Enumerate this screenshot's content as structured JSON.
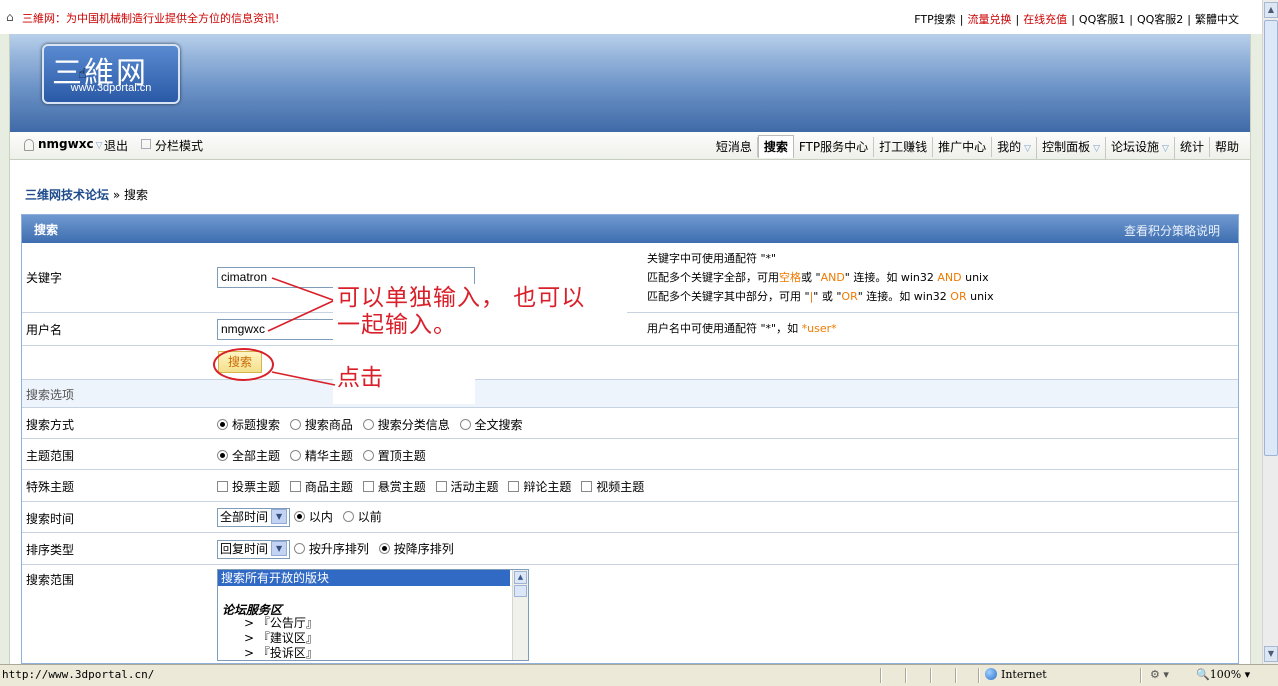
{
  "topbar": {
    "slogan": "三維网：为中国机械制造行业提供全方位的信息资讯!",
    "links": [
      "FTP搜索",
      "流量兑换",
      "在线充值",
      "QQ客服1",
      "QQ客服2",
      "繁體中文"
    ]
  },
  "logo": {
    "name": "三維网",
    "url": "www.3dportal.cn"
  },
  "userbar": {
    "username": "nmgwxc",
    "logout": "退出",
    "split_mode": "分栏模式"
  },
  "nav": {
    "items": [
      "短消息",
      "搜索",
      "FTP服务中心",
      "打工赚钱",
      "推广中心",
      "我的",
      "控制面板",
      "论坛设施",
      "统计",
      "帮助"
    ],
    "active": "搜索"
  },
  "breadcrumb": {
    "home": "三维网技术论坛",
    "sep": "»",
    "current": "搜索"
  },
  "panel": {
    "title": "搜索",
    "right_link": "查看积分策略说明"
  },
  "form": {
    "keyword_label": "关键字",
    "keyword_value": "cimatron",
    "keyword_tip1": "关键字中可使用通配符 \"*\"",
    "keyword_tip2_a": "匹配多个关键字全部，可用",
    "keyword_tip2_b": "空格",
    "keyword_tip2_c": "或 \"",
    "keyword_tip2_d": "AND",
    "keyword_tip2_e": "\" 连接。如 win32 ",
    "keyword_tip2_f": "AND",
    "keyword_tip2_g": " unix",
    "keyword_tip3_a": "匹配多个关键字其中部分，可用 \"",
    "keyword_tip3_b": "|",
    "keyword_tip3_c": "\" 或 \"",
    "keyword_tip3_d": "OR",
    "keyword_tip3_e": "\" 连接。如 win32 ",
    "keyword_tip3_f": "OR",
    "keyword_tip3_g": " unix",
    "username_label": "用户名",
    "username_value": "nmgwxc",
    "username_tip_a": "用户名中可使用通配符 \"*\"，如 ",
    "username_tip_b": "*user*",
    "search_button": "搜索",
    "options_header": "搜索选项",
    "method_label": "搜索方式",
    "method_options": [
      "标题搜索",
      "搜索商品",
      "搜索分类信息",
      "全文搜索"
    ],
    "method_selected": "标题搜索",
    "scope_label": "主题范围",
    "scope_options": [
      "全部主题",
      "精华主题",
      "置顶主题"
    ],
    "scope_selected": "全部主题",
    "special_label": "特殊主题",
    "special_options": [
      "投票主题",
      "商品主题",
      "悬赏主题",
      "活动主题",
      "辩论主题",
      "视频主题"
    ],
    "time_label": "搜索时间",
    "time_select": "全部时间",
    "time_options": [
      "以内",
      "以前"
    ],
    "time_selected": "以内",
    "sort_label": "排序类型",
    "sort_select": "回复时间",
    "sort_options": [
      "按升序排列",
      "按降序排列"
    ],
    "sort_selected": "按降序排列",
    "range_label": "搜索范围",
    "range_list": {
      "selected": "搜索所有开放的版块",
      "group": "论坛服务区",
      "items": [
        "> 『公告厅』",
        "> 『建议区』",
        "> 『投诉区』"
      ]
    }
  },
  "annotations": {
    "note1_line1": "可以单独输入， 也可以",
    "note1_line2": "一起输入。",
    "note2": "点击",
    "color": "#d9202a"
  },
  "statusbar": {
    "url": "http://www.3dportal.cn/",
    "zone": "Internet",
    "zoom": "100%"
  }
}
